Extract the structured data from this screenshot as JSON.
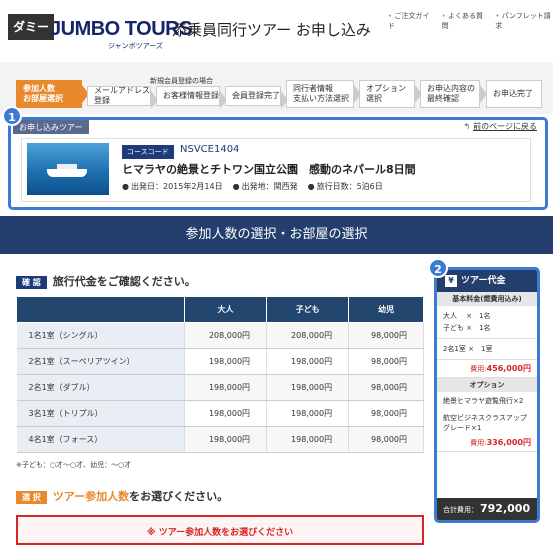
{
  "header": {
    "dummy_label": "ダミー",
    "brand": "JUMBO TOURS",
    "brand_sub": "ジャンボツアーズ",
    "title": "添乗員同行ツアー お申し込み",
    "links": [
      "ご注文ガイド",
      "よくある質問",
      "パンフレット請求"
    ]
  },
  "steps": {
    "group_label": "新規会員登録の場合",
    "items": [
      {
        "label": "参加人数\nお部屋選択",
        "active": true
      },
      {
        "label": "メールアドレス登録"
      },
      {
        "label": "お客様情報登録"
      },
      {
        "label": "会員登録完了"
      },
      {
        "label": "同行者情報\n支払い方法選択"
      },
      {
        "label": "オプション\n選択"
      },
      {
        "label": "お申込内容の\n最終確認"
      },
      {
        "label": "お申込完了"
      }
    ]
  },
  "tour": {
    "badge": "1",
    "label": "お申し込みツアー",
    "back_link": "前のページに戻る",
    "course_code_label": "コースコード",
    "course_code": "NSVCE1404",
    "name": "ヒマラヤの絶景とチトワン国立公園　感動のネパール8日間",
    "meta": [
      "出発日：2015年2月14日",
      "出発地：関西発",
      "旅行日数：5泊6日"
    ]
  },
  "section_title": "参加人数の選択・お部屋の選択",
  "confirm": {
    "tag": "確 認",
    "heading": "旅行代金をご確認ください。",
    "columns": [
      "",
      "大人",
      "子ども",
      "幼児"
    ],
    "rows": [
      {
        "room": "1名1室（シングル）",
        "adult": "208,000円",
        "child": "208,000円",
        "infant": "98,000円"
      },
      {
        "room": "2名1室（スーペリアツイン）",
        "adult": "198,000円",
        "child": "198,000円",
        "infant": "98,000円"
      },
      {
        "room": "2名1室（ダブル）",
        "adult": "198,000円",
        "child": "198,000円",
        "infant": "98,000円"
      },
      {
        "room": "3名1室（トリプル）",
        "adult": "198,000円",
        "child": "198,000円",
        "infant": "98,000円"
      },
      {
        "room": "4名1室（フォース）",
        "adult": "198,000円",
        "child": "198,000円",
        "infant": "98,000円"
      }
    ],
    "note": "※子ども：○才〜○才、幼児：〜○才"
  },
  "select": {
    "tag": "選 択",
    "heading_accent": "ツアー参加人数",
    "heading_rest": "をお選びください。",
    "warning": "※ ツアー参加人数をお選びください"
  },
  "side": {
    "badge": "2",
    "title": "ツアー代金",
    "sub": "基本料金(燃費用込み)",
    "lines1": [
      "大人　 ×　1名",
      "子ども ×　1名"
    ],
    "line_room": "2名1室 ×　1室",
    "total1_label": "費用:",
    "total1": "456,000円",
    "option_head": "オプション",
    "option1": "絶景ヒマラヤ遊覧飛行×2",
    "option2": "航空ビジネスクラスアップグレード×1",
    "total2_label": "費用:",
    "total2": "336,000円",
    "grand_label": "合計費用：",
    "grand": "792,000円"
  }
}
